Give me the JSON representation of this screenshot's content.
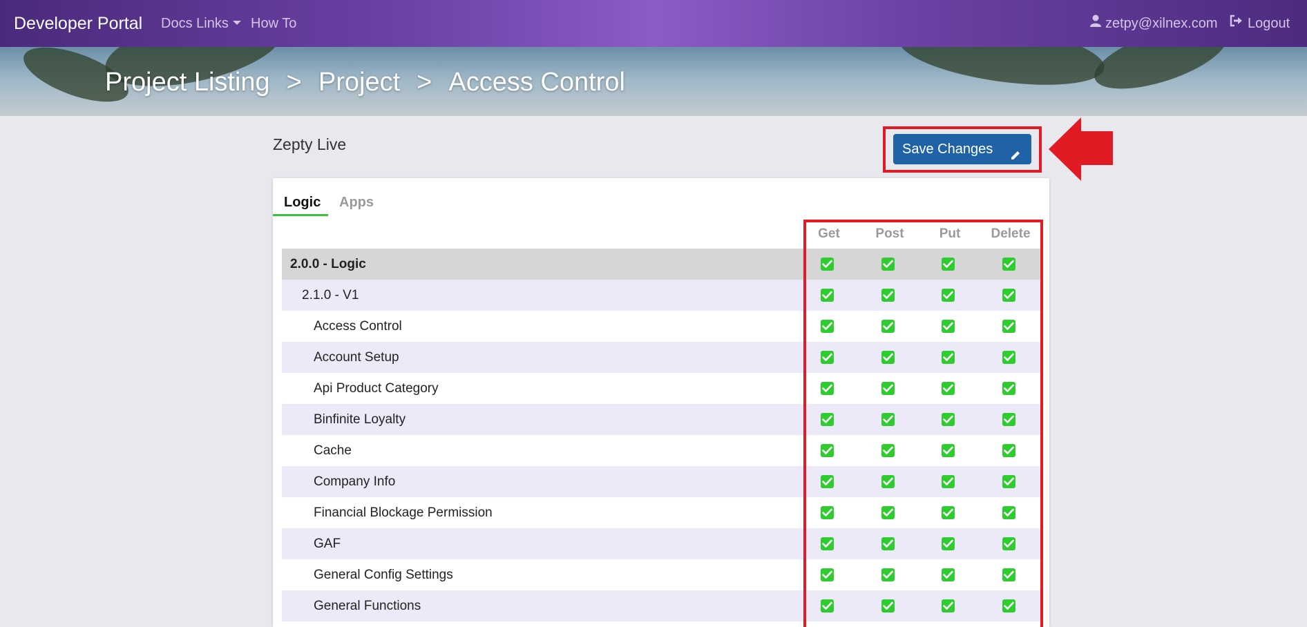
{
  "navbar": {
    "brand": "Developer Portal",
    "docs_links": "Docs Links",
    "how_to": "How To",
    "user_email": "zetpy@xilnex.com",
    "logout": "Logout"
  },
  "breadcrumb": {
    "items": [
      "Project Listing",
      "Project",
      "Access Control"
    ],
    "separator": ">"
  },
  "project": {
    "name": "Zepty Live"
  },
  "toolbar": {
    "save_label": "Save Changes"
  },
  "tabs": [
    {
      "label": "Logic",
      "active": true
    },
    {
      "label": "Apps",
      "active": false
    }
  ],
  "columns": [
    "Get",
    "Post",
    "Put",
    "Delete"
  ],
  "rows": [
    {
      "label": "2.0.0 - Logic",
      "level": 0,
      "get": true,
      "post": true,
      "put": true,
      "delete": true
    },
    {
      "label": "2.1.0 - V1",
      "level": 1,
      "get": true,
      "post": true,
      "put": true,
      "delete": true
    },
    {
      "label": "Access Control",
      "level": 2,
      "get": true,
      "post": true,
      "put": true,
      "delete": true
    },
    {
      "label": "Account Setup",
      "level": 2,
      "get": true,
      "post": true,
      "put": true,
      "delete": true
    },
    {
      "label": "Api Product Category",
      "level": 2,
      "get": true,
      "post": true,
      "put": true,
      "delete": true
    },
    {
      "label": "Binfinite Loyalty",
      "level": 2,
      "get": true,
      "post": true,
      "put": true,
      "delete": true
    },
    {
      "label": "Cache",
      "level": 2,
      "get": true,
      "post": true,
      "put": true,
      "delete": true
    },
    {
      "label": "Company Info",
      "level": 2,
      "get": true,
      "post": true,
      "put": true,
      "delete": true
    },
    {
      "label": "Financial Blockage Permission",
      "level": 2,
      "get": true,
      "post": true,
      "put": true,
      "delete": true
    },
    {
      "label": "GAF",
      "level": 2,
      "get": true,
      "post": true,
      "put": true,
      "delete": true
    },
    {
      "label": "General Config Settings",
      "level": 2,
      "get": true,
      "post": true,
      "put": true,
      "delete": true
    },
    {
      "label": "General Functions",
      "level": 2,
      "get": true,
      "post": true,
      "put": true,
      "delete": true
    }
  ],
  "colors": {
    "accent_green": "#2ecc2e",
    "save_button": "#1f63a6",
    "highlight_red": "#e01b24",
    "row_alt": "#eceaf8",
    "row_header": "#d6d6d6"
  }
}
